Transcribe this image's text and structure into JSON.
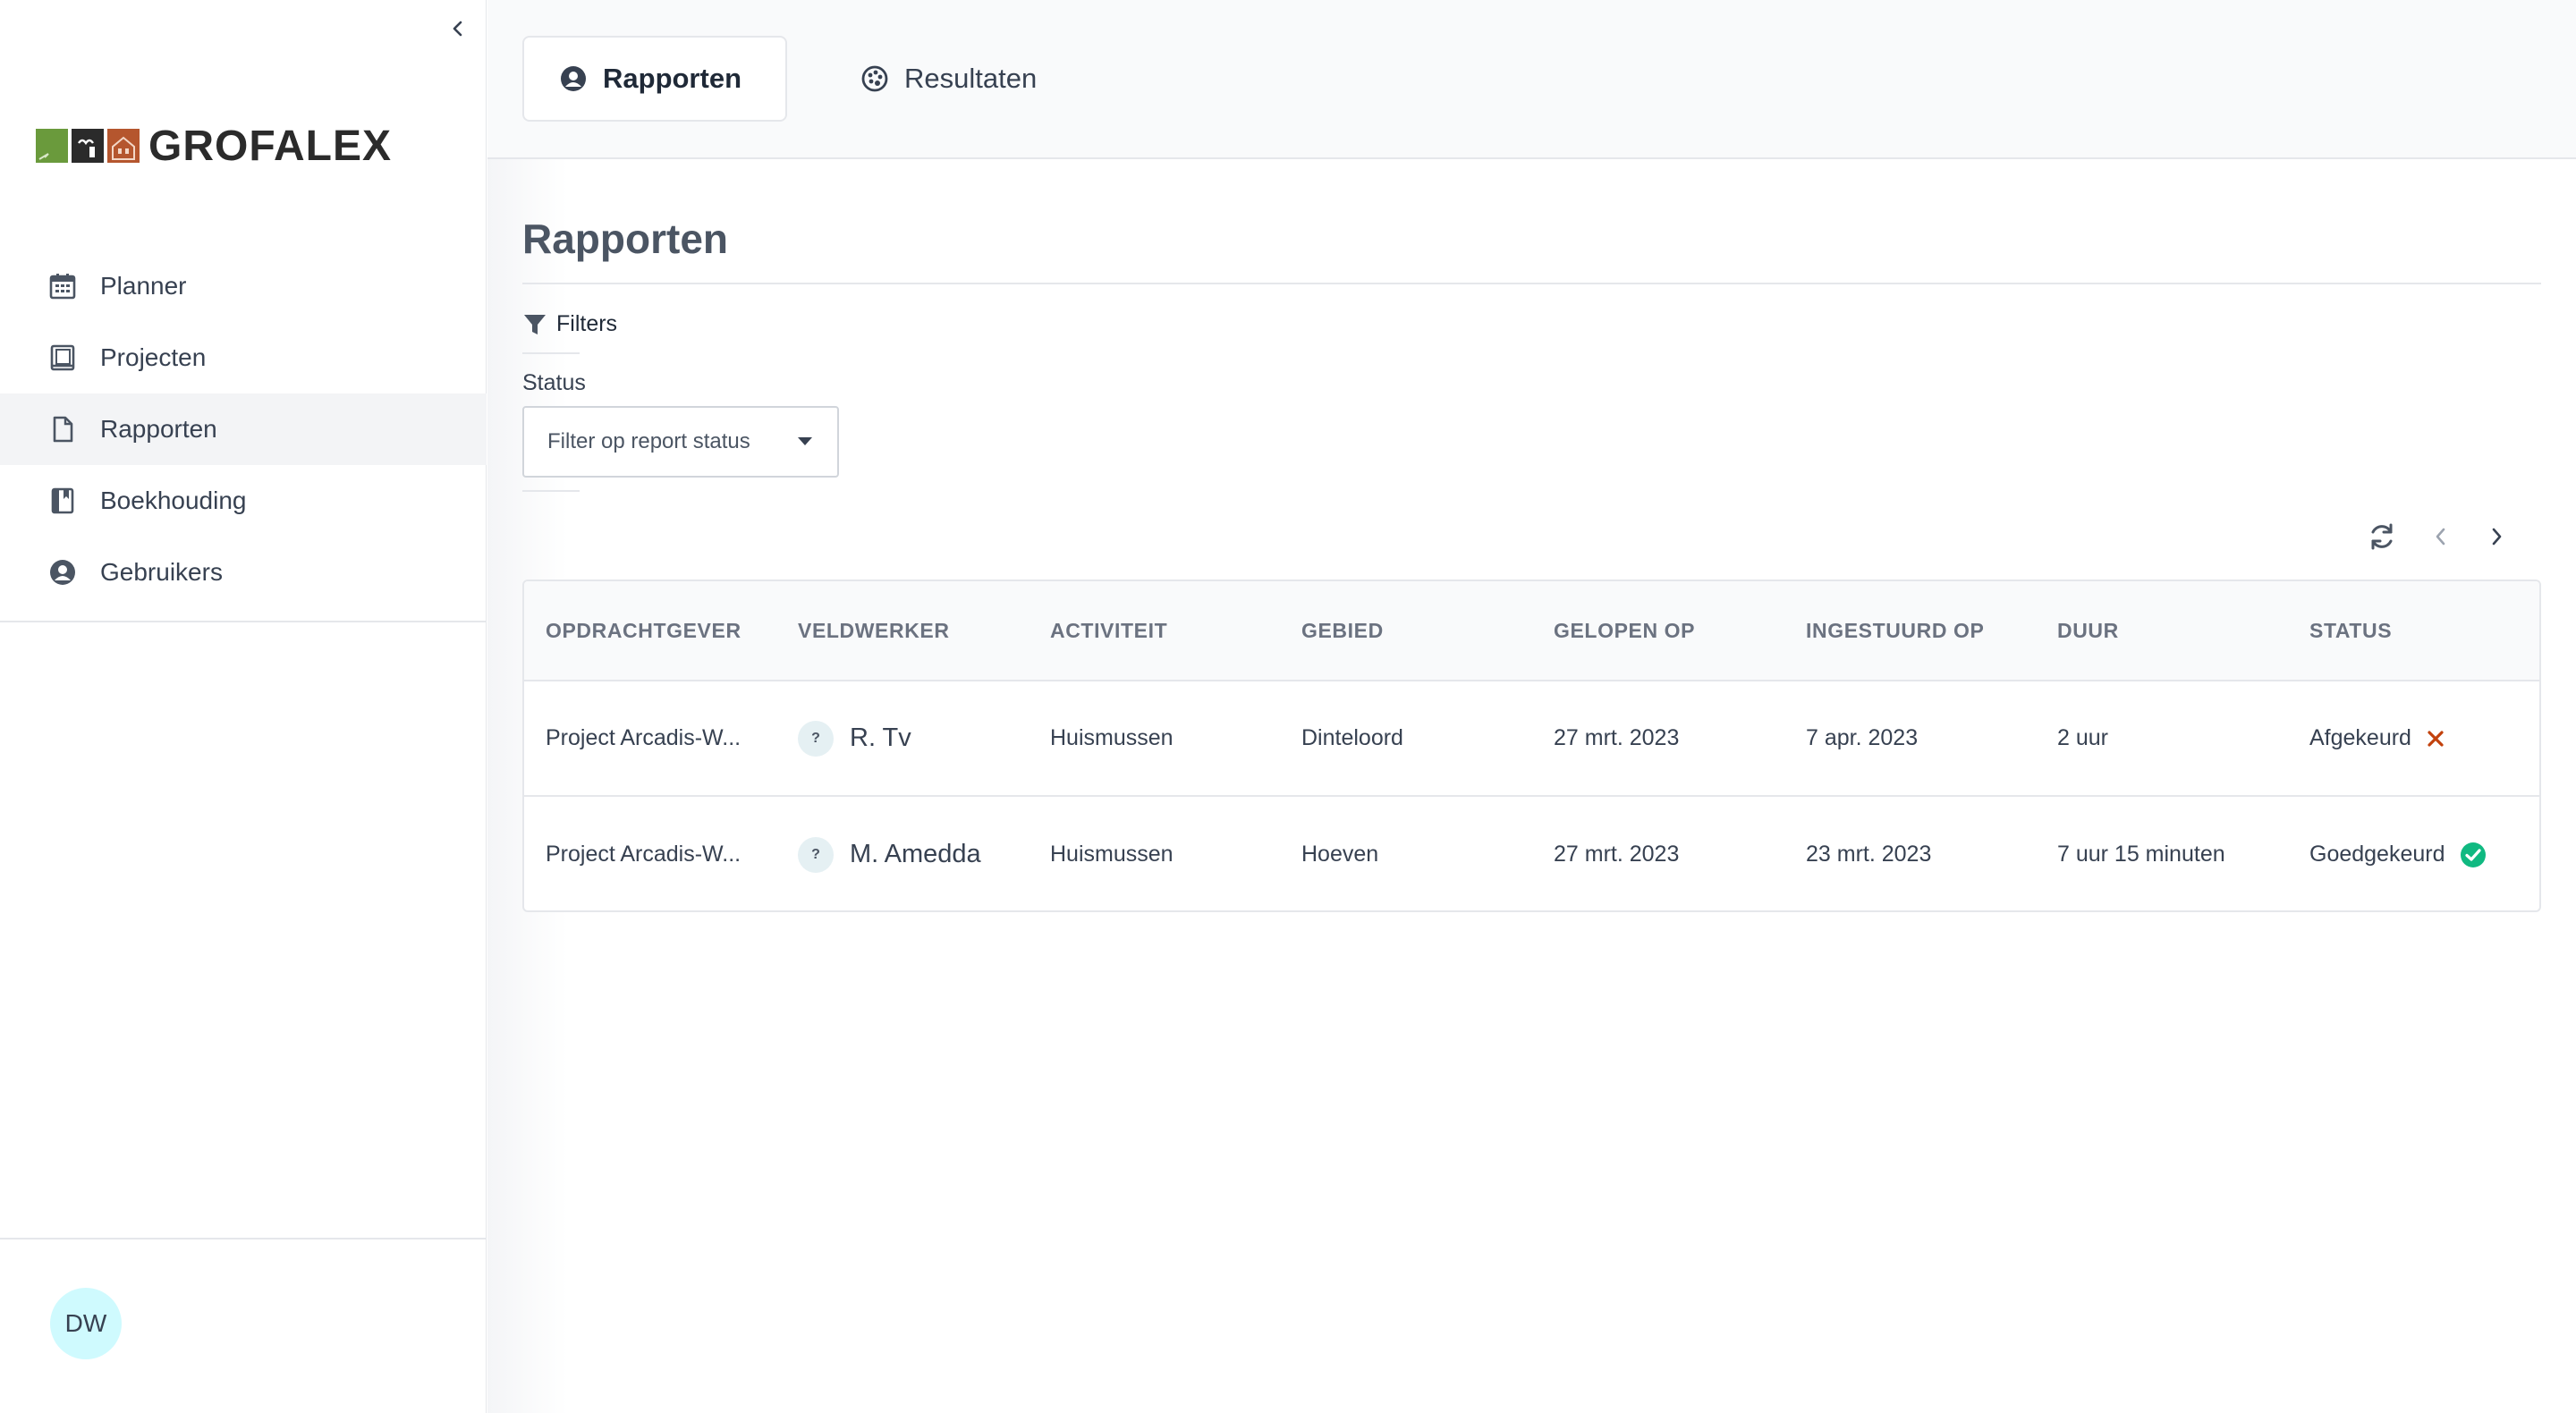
{
  "brand": {
    "name": "GROFALEX",
    "tile_colors": [
      "#6a9a3c",
      "#2b2b2b",
      "#b5562e"
    ]
  },
  "sidebar": {
    "items": [
      {
        "label": "Planner",
        "icon": "calendar-icon"
      },
      {
        "label": "Projecten",
        "icon": "book-icon"
      },
      {
        "label": "Rapporten",
        "icon": "document-icon",
        "active": true
      },
      {
        "label": "Boekhouding",
        "icon": "ledger-icon"
      },
      {
        "label": "Gebruikers",
        "icon": "user-circle-icon"
      }
    ],
    "user_initials": "DW"
  },
  "tabs": [
    {
      "label": "Rapporten",
      "icon": "user-circle-icon",
      "active": true
    },
    {
      "label": "Resultaten",
      "icon": "palette-icon",
      "active": false
    }
  ],
  "page": {
    "title": "Rapporten",
    "filters_label": "Filters",
    "status_label": "Status",
    "status_select_placeholder": "Filter op report status"
  },
  "table": {
    "columns": [
      "OPDRACHTGEVER",
      "VELDWERKER",
      "ACTIVITEIT",
      "GEBIED",
      "GELOPEN OP",
      "INGESTUURD OP",
      "DUUR",
      "STATUS"
    ],
    "rows": [
      {
        "client": "Project Arcadis-W...",
        "worker_avatar": "?",
        "worker": "R. Tv",
        "activity": "Huismussen",
        "area": "Dinteloord",
        "walked_on": "27 mrt. 2023",
        "submitted_on": "7 apr. 2023",
        "duration": "2 uur",
        "status": "Afgekeurd",
        "status_icon": "x-icon"
      },
      {
        "client": "Project Arcadis-W...",
        "worker_avatar": "?",
        "worker": "M. Amedda",
        "activity": "Huismussen",
        "area": "Hoeven",
        "walked_on": "27 mrt. 2023",
        "submitted_on": "23 mrt. 2023",
        "duration": "7 uur 15 minuten",
        "status": "Goedgekeurd",
        "status_icon": "check-circle-icon"
      }
    ]
  },
  "colors": {
    "rejected": "#c2410c",
    "approved": "#10b981"
  }
}
